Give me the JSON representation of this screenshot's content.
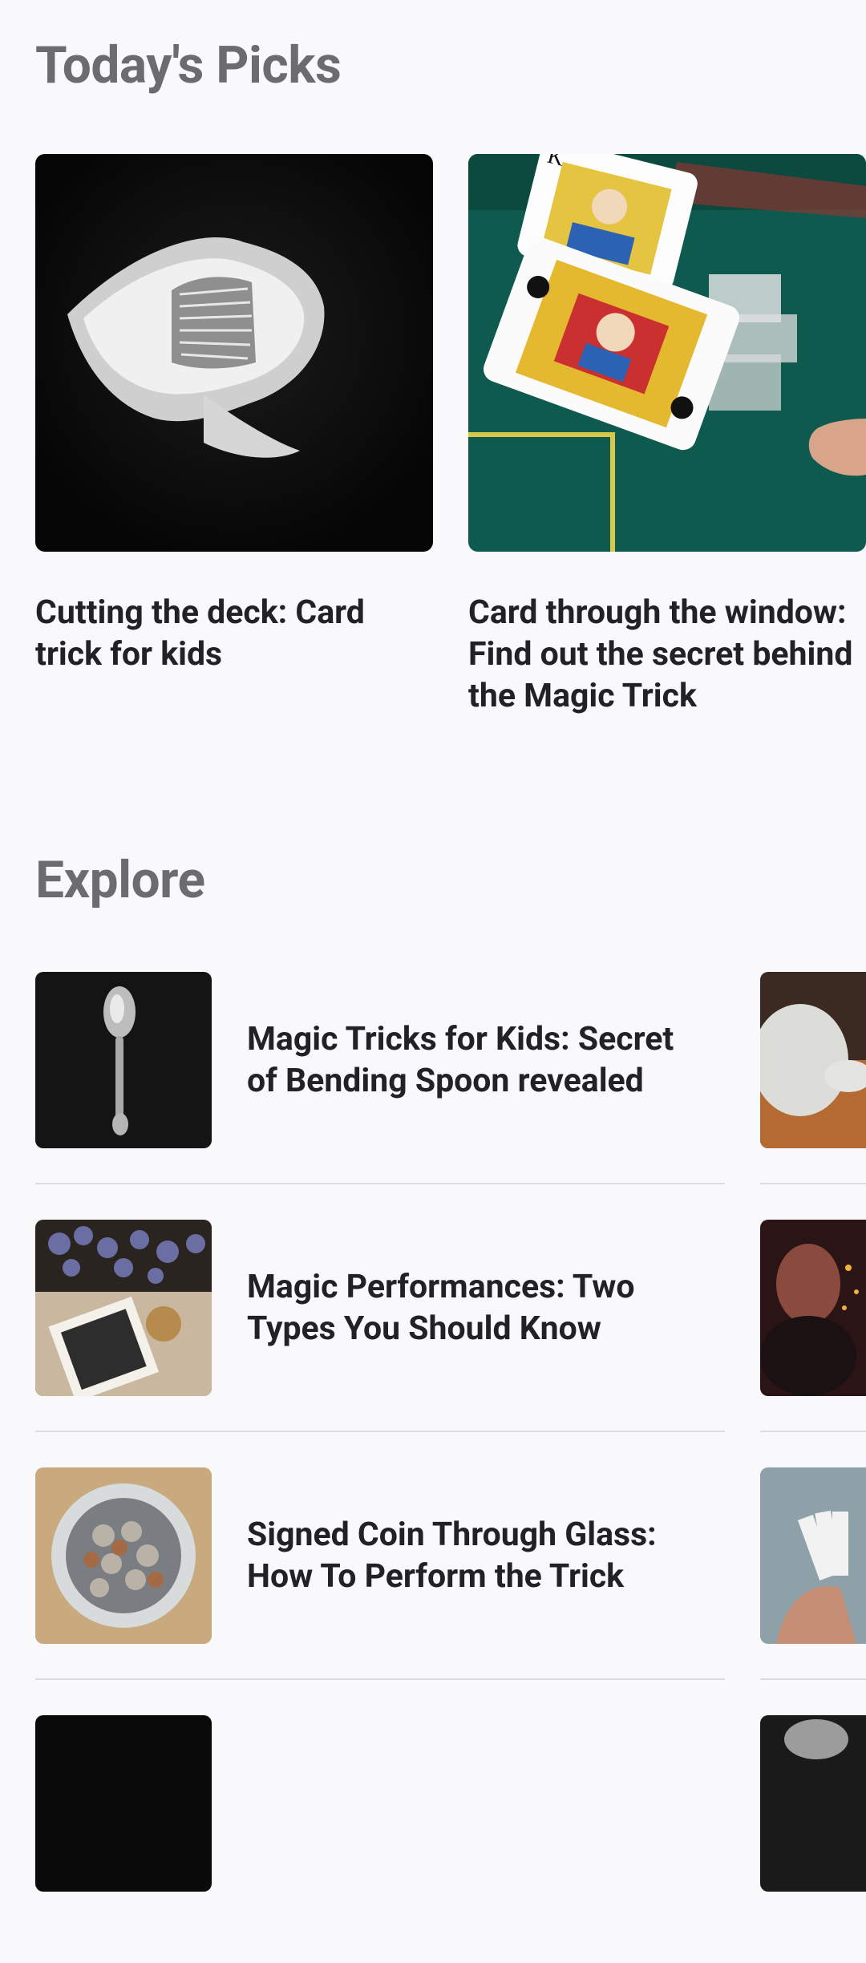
{
  "sections": {
    "todays_picks_title": "Today's Picks",
    "explore_title": "Explore"
  },
  "todays_picks": [
    {
      "title": "Cutting the deck: Card trick for kids",
      "image": "gloved-hands-cards-photo"
    },
    {
      "title": "Card through the window: Find out the secret behind the Magic Trick",
      "image": "king-cards-green-table-photo"
    }
  ],
  "explore": [
    {
      "title": "Magic Tricks for Kids: Secret of Bending Spoon revealed",
      "image": "spoon-photo"
    },
    {
      "title": "Magic Performances: Two Types You Should Know",
      "image": "lavender-tarot-photo"
    },
    {
      "title": "Signed Coin Through Glass: How To Perform the Trick",
      "image": "coin-jar-photo"
    }
  ],
  "explore_peek": [
    {
      "image": "silver-coins-photo"
    },
    {
      "image": "woman-lights-photo"
    },
    {
      "image": "hand-cards-photo"
    }
  ]
}
